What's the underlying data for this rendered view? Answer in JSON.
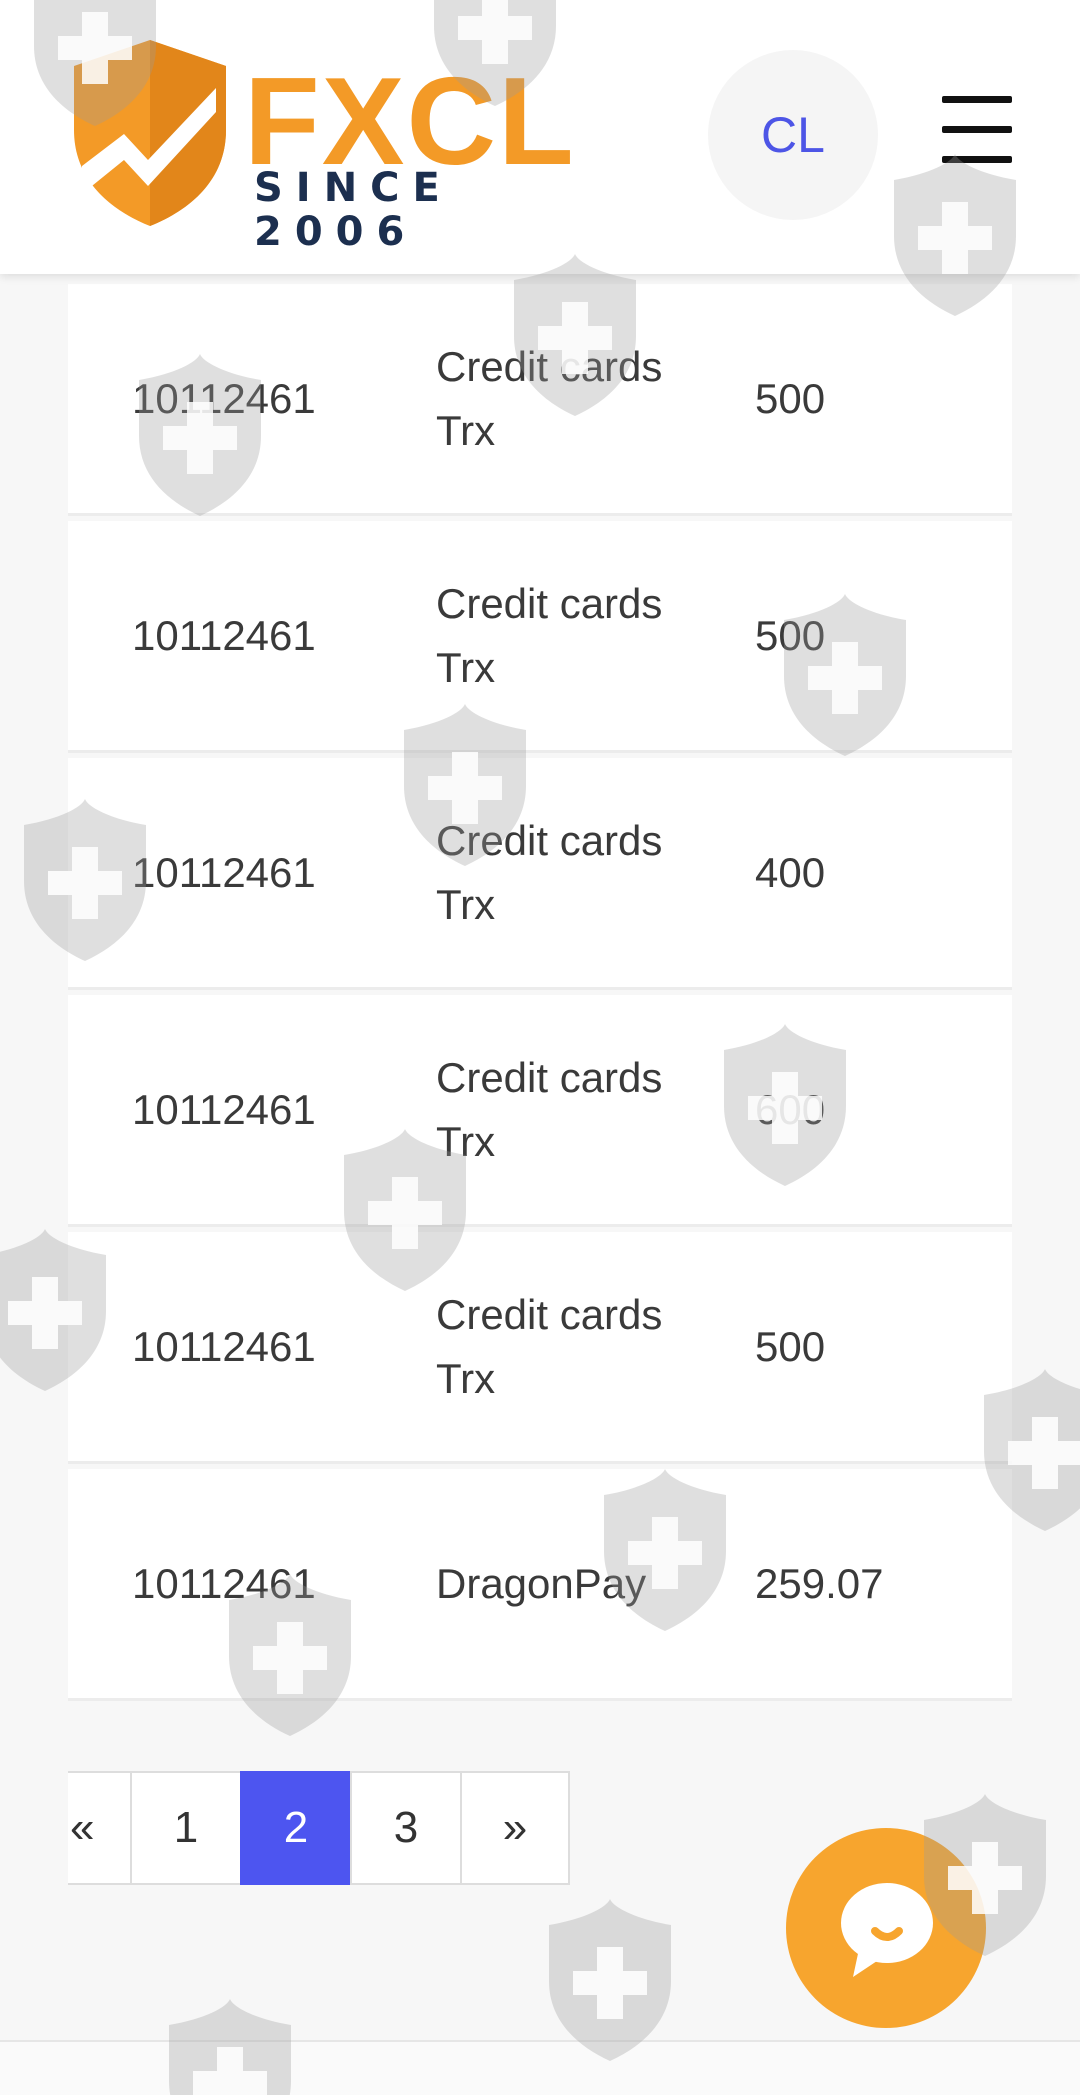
{
  "header": {
    "logo_text": "FXCL",
    "logo_tagline": "SINCE 2006",
    "language_label": "CL",
    "menu_icon": "hamburger-menu-icon"
  },
  "transactions": [
    {
      "id": "10112461",
      "method": "Credit cards Trx",
      "amount": "500"
    },
    {
      "id": "10112461",
      "method": "Credit cards Trx",
      "amount": "500"
    },
    {
      "id": "10112461",
      "method": "Credit cards Trx",
      "amount": "400"
    },
    {
      "id": "10112461",
      "method": "Credit cards Trx",
      "amount": "600"
    },
    {
      "id": "10112461",
      "method": "Credit cards Trx",
      "amount": "500"
    },
    {
      "id": "10112461",
      "method": "DragonPay",
      "amount": "259.07"
    }
  ],
  "pagination": {
    "prev": "«",
    "pages": [
      "1",
      "2",
      "3"
    ],
    "current": "2",
    "next": "»"
  },
  "chat": {
    "icon": "chat-bubble-icon"
  },
  "colors": {
    "brand_orange": "#f39a27",
    "brand_navy": "#1c2f4f",
    "accent_blue": "#4d55f0",
    "chat_orange": "#f7a52e"
  }
}
